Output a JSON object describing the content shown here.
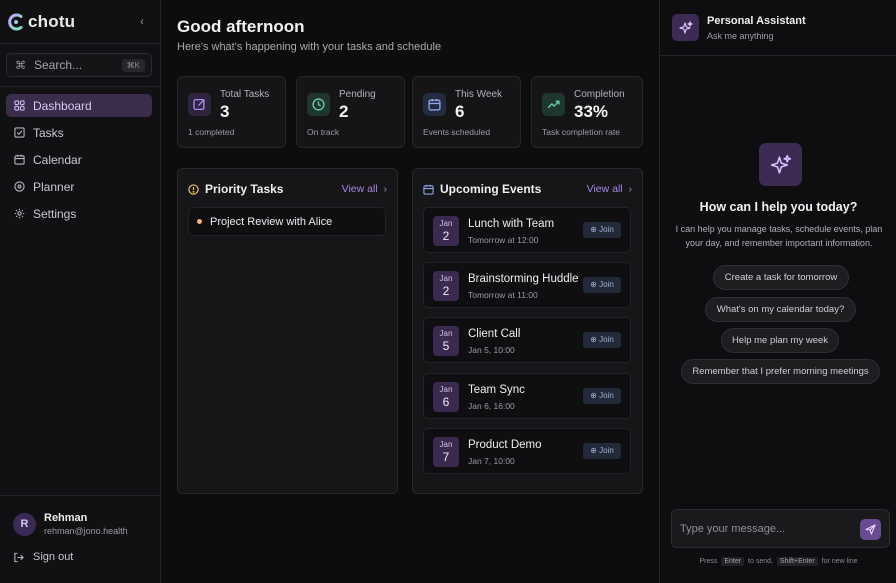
{
  "app": {
    "name": "chotu",
    "collapse_icon": "chevron-left-icon"
  },
  "search": {
    "placeholder": "Search...",
    "shortcut": "⌘K"
  },
  "nav": [
    {
      "label": "Dashboard",
      "icon": "grid-icon",
      "active": true
    },
    {
      "label": "Tasks",
      "icon": "checkbox-icon",
      "active": false
    },
    {
      "label": "Calendar",
      "icon": "calendar-icon",
      "active": false
    },
    {
      "label": "Planner",
      "icon": "target-icon",
      "active": false
    },
    {
      "label": "Settings",
      "icon": "gear-icon",
      "active": false
    }
  ],
  "user": {
    "initial": "R",
    "name": "Rehman",
    "email": "rehman@jono.health"
  },
  "signout": {
    "label": "Sign out"
  },
  "header": {
    "greeting": "Good afternoon",
    "subtitle": "Here's what's happening with your tasks and schedule"
  },
  "stats": [
    {
      "label": "Total Tasks",
      "value": "3",
      "sub": "1 completed",
      "icon": "edit-icon",
      "color": "#b48df0"
    },
    {
      "label": "Pending",
      "value": "2",
      "sub": "On track",
      "icon": "clock-icon",
      "color": "#6fd3a8"
    },
    {
      "label": "This Week",
      "value": "6",
      "sub": "Events scheduled",
      "icon": "calendar-icon",
      "color": "#8ea4e8"
    },
    {
      "label": "Completion",
      "value": "33%",
      "sub": "Task completion rate",
      "icon": "trending-up-icon",
      "color": "#6fd3a8"
    }
  ],
  "priority": {
    "title": "Priority Tasks",
    "view_all": "View all",
    "tasks": [
      {
        "title": "Project Review with Alice"
      }
    ]
  },
  "events": {
    "title": "Upcoming Events",
    "view_all": "View all",
    "items": [
      {
        "month": "Jan",
        "day": "2",
        "title": "Lunch with Team",
        "time": "Tomorrow at 12:00",
        "join": "⊕ Join"
      },
      {
        "month": "Jan",
        "day": "2",
        "title": "Brainstorming Huddle",
        "time": "Tomorrow at 11:00",
        "join": "⊕ Join"
      },
      {
        "month": "Jan",
        "day": "5",
        "title": "Client Call",
        "time": "Jan 5, 10:00",
        "join": "⊕ Join"
      },
      {
        "month": "Jan",
        "day": "6",
        "title": "Team Sync",
        "time": "Jan 6, 16:00",
        "join": "⊕ Join"
      },
      {
        "month": "Jan",
        "day": "7",
        "title": "Product Demo",
        "time": "Jan 7, 10:00",
        "join": "⊕ Join"
      }
    ]
  },
  "assistant": {
    "title": "Personal Assistant",
    "subtitle": "Ask me anything",
    "hero_title": "How can I help you today?",
    "hero_desc": "I can help you manage tasks, schedule events, plan your day, and remember important information.",
    "suggestions": [
      "Create a task for tomorrow",
      "What's on my calendar today?",
      "Help me plan my week",
      "Remember that I prefer morning meetings"
    ],
    "input_placeholder": "Type your message...",
    "hint_press": "Press",
    "hint_enter": "Enter",
    "hint_to_send": "to send,",
    "hint_shift": "Shift+Enter",
    "hint_newline": "for new line"
  }
}
